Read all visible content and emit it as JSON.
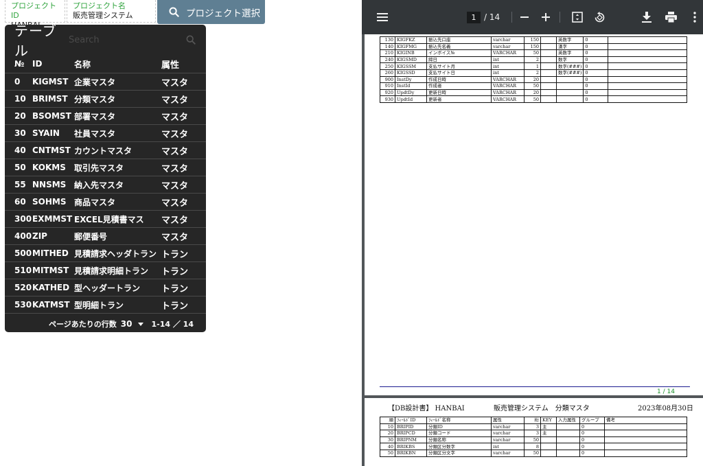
{
  "project": {
    "id_label": "プロジェクトID",
    "id_value": "HANBAI",
    "name_label": "プロジェクト名",
    "name_value": "販売管理システム",
    "select_button": "プロジェクト選択"
  },
  "table_panel": {
    "title": "テーブル",
    "search_placeholder": "Search",
    "columns": {
      "no": "№",
      "id": "ID",
      "name": "名称",
      "attr": "属性"
    },
    "rows": [
      {
        "no": "0",
        "id": "KIGMST",
        "name": "企業マスタ",
        "attr": "マスタ"
      },
      {
        "no": "10",
        "id": "BRIMST",
        "name": "分類マスタ",
        "attr": "マスタ"
      },
      {
        "no": "20",
        "id": "BSOMST",
        "name": "部署マスタ",
        "attr": "マスタ"
      },
      {
        "no": "30",
        "id": "SYAIN",
        "name": "社員マスタ",
        "attr": "マスタ"
      },
      {
        "no": "40",
        "id": "CNTMST",
        "name": "カウントマスタ",
        "attr": "マスタ"
      },
      {
        "no": "50",
        "id": "KOKMS",
        "name": "取引先マスタ",
        "attr": "マスタ"
      },
      {
        "no": "55",
        "id": "NNSMS",
        "name": "納入先マスタ",
        "attr": "マスタ"
      },
      {
        "no": "60",
        "id": "SOHMS",
        "name": "商品マスタ",
        "attr": "マスタ"
      },
      {
        "no": "300",
        "id": "EXMMST",
        "name": "EXCEL見積書マス",
        "attr": "マスタ"
      },
      {
        "no": "400",
        "id": "ZIP",
        "name": "郵便番号",
        "attr": "マスタ"
      },
      {
        "no": "500",
        "id": "MITHED",
        "name": "見積請求ヘッダトラン",
        "attr": "トラン"
      },
      {
        "no": "510",
        "id": "MITMST",
        "name": "見積請求明細トラン",
        "attr": "トラン"
      },
      {
        "no": "520",
        "id": "KATHED",
        "name": "型ヘッダートラン",
        "attr": "トラン"
      },
      {
        "no": "530",
        "id": "KATMST",
        "name": "型明細トラン",
        "attr": "トラン"
      }
    ],
    "pager": {
      "rows_label": "ページあたりの行数",
      "rows_value": "30",
      "range": "1-14 ／ 14"
    }
  },
  "pdf_viewer": {
    "current_page": "1",
    "total": "/ 14",
    "icons": [
      "menu-icon",
      "zoom-out-icon",
      "zoom-in-icon",
      "fit-page-icon",
      "rotate-icon",
      "download-icon",
      "print-icon",
      "more-icon"
    ],
    "page1": {
      "footer": "1 / 14",
      "rows": [
        [
          "130",
          "KIGFKZ",
          "振込先口座",
          "varchar",
          "150",
          "",
          "英数字",
          "0",
          ""
        ],
        [
          "140",
          "KIGFMG",
          "振込先名義",
          "varchar",
          "150",
          "",
          "漢字",
          "0",
          ""
        ],
        [
          "210",
          "KIGINB",
          "インボイス№",
          "VARCHAR",
          "50",
          "",
          "英数字",
          "0",
          ""
        ],
        [
          "240",
          "KIGSMD",
          "締日",
          "int",
          "2",
          "",
          "数字",
          "0",
          ""
        ],
        [
          "250",
          "KIGSSM",
          "支払サイト月",
          "int",
          "1",
          "",
          "数字(###)",
          "0",
          ""
        ],
        [
          "260",
          "KIGSSD",
          "支払サイト日",
          "int",
          "2",
          "",
          "数字(###)",
          "0",
          ""
        ],
        [
          "900",
          "InstDy",
          "作成日時",
          "VARCHAR",
          "20",
          "",
          "",
          "0",
          ""
        ],
        [
          "910",
          "InstId",
          "作成者",
          "VARCHAR",
          "50",
          "",
          "",
          "0",
          ""
        ],
        [
          "920",
          "UpdtDy",
          "更新日時",
          "VARCHAR",
          "20",
          "",
          "",
          "0",
          ""
        ],
        [
          "930",
          "UpdtId",
          "更新者",
          "VARCHAR",
          "50",
          "",
          "",
          "0",
          ""
        ]
      ]
    },
    "page2": {
      "doc_title": "【DB設計書】 HANBAI",
      "system_table": "販売管理システム　分類マスタ",
      "date": "2023年08月30日",
      "header": [
        "順",
        "ﾌｨｰﾙﾄﾞID",
        "ﾌｨｰﾙﾄﾞ名称",
        "属性",
        "桁",
        "KEY",
        "入力属性",
        "グループ",
        "備考"
      ],
      "rows": [
        [
          "10",
          "BRIPID",
          "分類ID",
          "varchar",
          "3",
          "主",
          "",
          "0",
          ""
        ],
        [
          "20",
          "BRIPCD",
          "分類コード",
          "varchar",
          "3",
          "主",
          "",
          "0",
          ""
        ],
        [
          "30",
          "BRIPNM",
          "分類名称",
          "varchar",
          "50",
          "",
          "",
          "0",
          ""
        ],
        [
          "40",
          "BRIKBS",
          "分類区分数字",
          "int",
          "8",
          "",
          "",
          "0",
          ""
        ],
        [
          "50",
          "BRIKBN",
          "分類区分文字",
          "varchar",
          "50",
          "",
          "",
          "0",
          ""
        ]
      ]
    }
  },
  "colors": {
    "panel_bg": "#262626",
    "button_bg": "#5f7f93",
    "label_green": "#2fa33d",
    "pdf_toolbar": "#323639",
    "pdf_bg": "#525659"
  }
}
